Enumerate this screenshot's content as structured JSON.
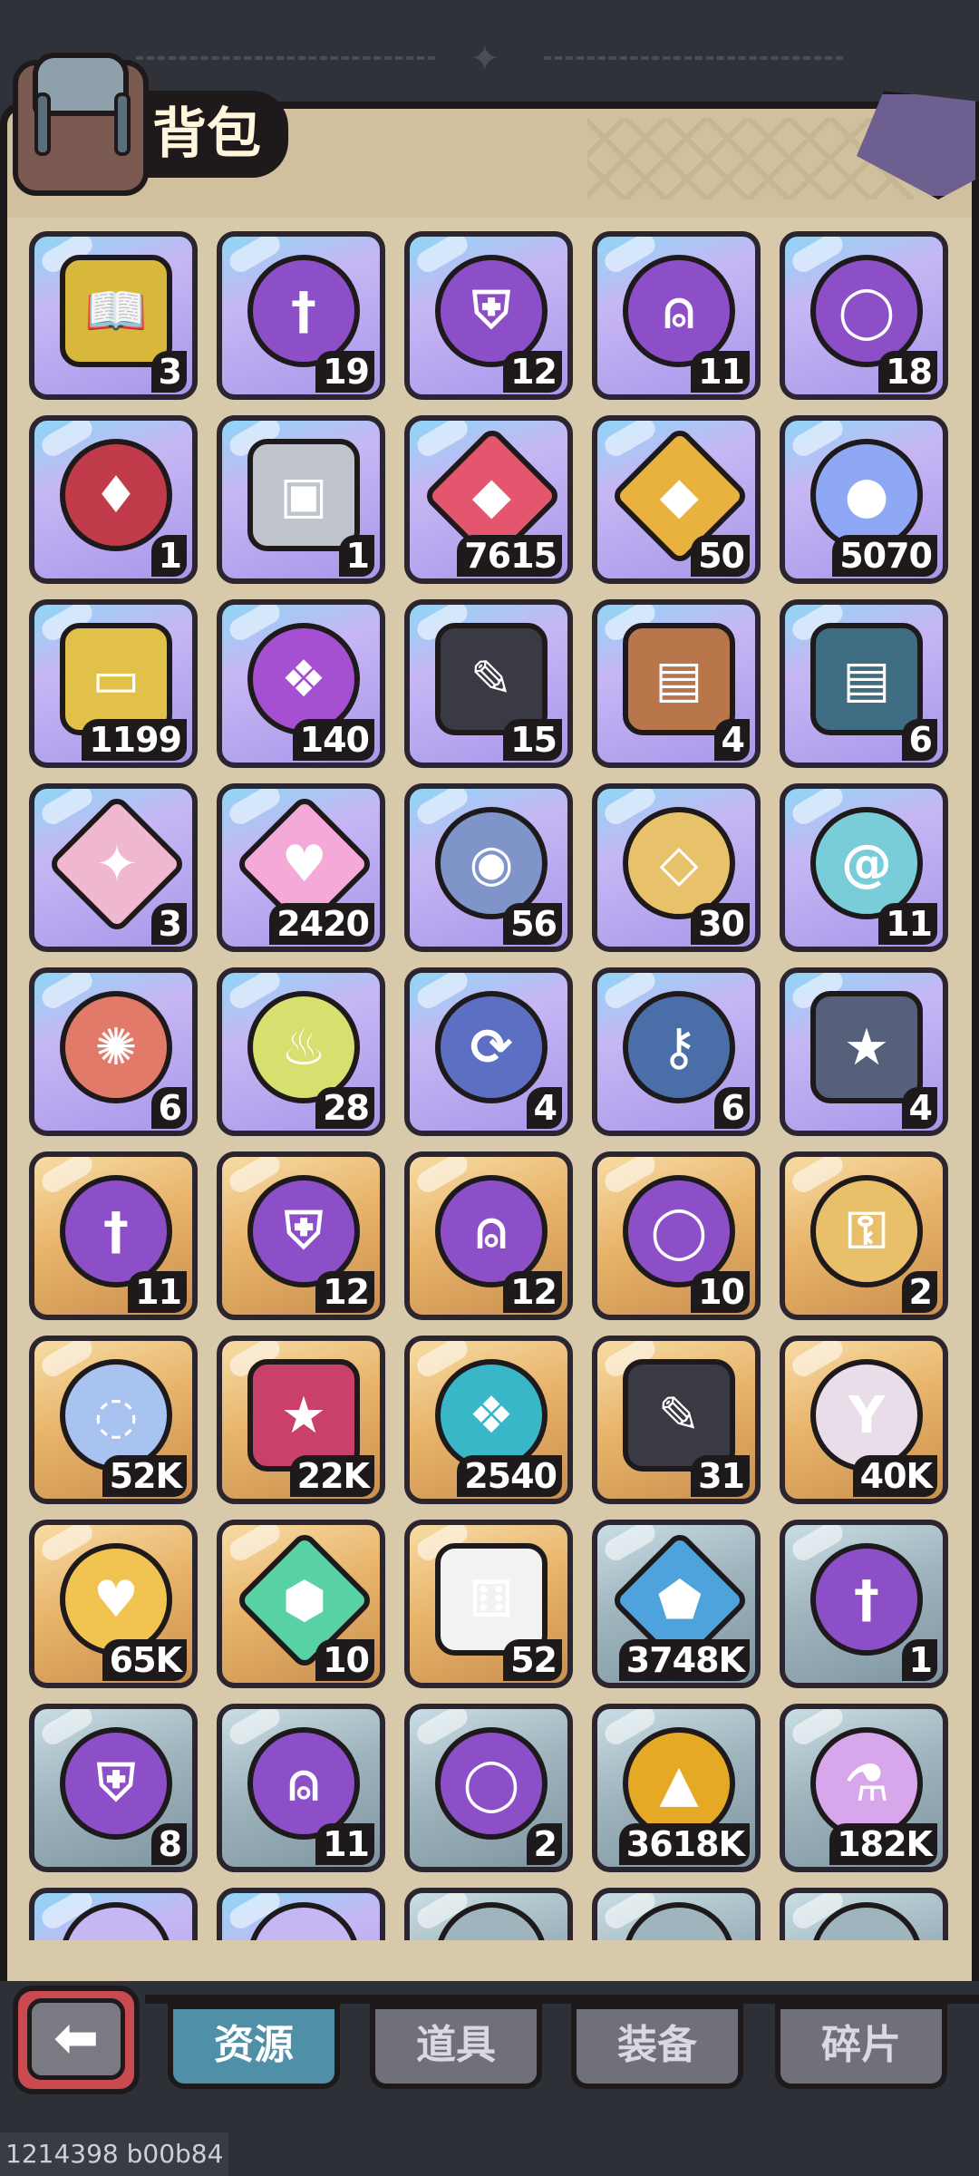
{
  "header": {
    "title": "背包"
  },
  "tabs": [
    {
      "label": "资源",
      "active": true
    },
    {
      "label": "道具",
      "active": false
    },
    {
      "label": "装备",
      "active": false
    },
    {
      "label": "碎片",
      "active": false
    }
  ],
  "items": [
    {
      "icon": "gold-book-icon",
      "count": "3",
      "frame": "purple",
      "color": "#d8b83a"
    },
    {
      "icon": "sword-orb-icon",
      "count": "19",
      "frame": "purple",
      "color": "#8c4fc7"
    },
    {
      "icon": "armor-orb-icon",
      "count": "12",
      "frame": "purple",
      "color": "#8c4fc7"
    },
    {
      "icon": "helmet-orb-icon",
      "count": "11",
      "frame": "purple",
      "color": "#8c4fc7"
    },
    {
      "icon": "ring-orb-icon",
      "count": "18",
      "frame": "purple",
      "color": "#8c4fc7"
    },
    {
      "icon": "winged-helmet-emblem-icon",
      "count": "1",
      "frame": "purple",
      "color": "#c23b4a"
    },
    {
      "icon": "ink-device-icon",
      "count": "1",
      "frame": "purple",
      "color": "#bfc4cc"
    },
    {
      "icon": "red-gem-icon",
      "count": "7615",
      "frame": "purple",
      "color": "#e3566e"
    },
    {
      "icon": "gold-gem-icon",
      "count": "50",
      "frame": "purple",
      "color": "#e9b23e"
    },
    {
      "icon": "blue-slime-icon",
      "count": "5070",
      "frame": "purple",
      "color": "#8fa8f5"
    },
    {
      "icon": "match-ticket-icon",
      "count": "1199",
      "frame": "purple",
      "color": "#e2c14b"
    },
    {
      "icon": "purple-crest-icon",
      "count": "140",
      "frame": "purple",
      "color": "#a54fd1"
    },
    {
      "icon": "feather-box-icon",
      "count": "15",
      "frame": "purple",
      "color": "#3a3a44"
    },
    {
      "icon": "red-helmet-book-icon",
      "count": "4",
      "frame": "purple",
      "color": "#b8764a"
    },
    {
      "icon": "blue-helmet-book-icon",
      "count": "6",
      "frame": "purple",
      "color": "#3f6e84"
    },
    {
      "icon": "prism-crystal-icon",
      "count": "3",
      "frame": "purple",
      "color": "#f0b8d0"
    },
    {
      "icon": "crystal-heart-icon",
      "count": "2420",
      "frame": "purple",
      "color": "#f5a9d8"
    },
    {
      "icon": "eye-stone-icon",
      "count": "56",
      "frame": "purple",
      "color": "#7f95c9"
    },
    {
      "icon": "gold-diamond-stone-icon",
      "count": "30",
      "frame": "purple",
      "color": "#e8c26a"
    },
    {
      "icon": "spiral-stone-icon",
      "count": "11",
      "frame": "purple",
      "color": "#79cdd9"
    },
    {
      "icon": "gear-stone-icon",
      "count": "6",
      "frame": "purple",
      "color": "#e27a6a"
    },
    {
      "icon": "flame-stone-icon",
      "count": "28",
      "frame": "purple",
      "color": "#d7df6e"
    },
    {
      "icon": "refresh-orb-icon",
      "count": "4",
      "frame": "purple",
      "color": "#5d6fc2"
    },
    {
      "icon": "key-icon",
      "count": "6",
      "frame": "purple",
      "color": "#4a6fa8"
    },
    {
      "icon": "star-tome-icon",
      "count": "4",
      "frame": "purple",
      "color": "#56607a"
    },
    {
      "icon": "sword-orb-icon",
      "count": "11",
      "frame": "gold",
      "color": "#8c4fc7"
    },
    {
      "icon": "armor-orb-icon",
      "count": "12",
      "frame": "gold",
      "color": "#8c4fc7"
    },
    {
      "icon": "helmet-orb-icon",
      "count": "12",
      "frame": "gold",
      "color": "#8c4fc7"
    },
    {
      "icon": "ring-orb-icon",
      "count": "10",
      "frame": "gold",
      "color": "#8c4fc7"
    },
    {
      "icon": "gold-key-icon",
      "count": "2",
      "frame": "gold",
      "color": "#e9c06a"
    },
    {
      "icon": "shell-orb-icon",
      "count": "52K",
      "frame": "gold",
      "color": "#a9c3f0"
    },
    {
      "icon": "star-banner-icon",
      "count": "22K",
      "frame": "gold",
      "color": "#c9416b"
    },
    {
      "icon": "teal-crest-icon",
      "count": "2540",
      "frame": "gold",
      "color": "#39b7c9"
    },
    {
      "icon": "feather-box-icon",
      "count": "31",
      "frame": "gold",
      "color": "#3a3a44"
    },
    {
      "icon": "goblet-icon",
      "count": "40K",
      "frame": "gold",
      "color": "#e8dde8"
    },
    {
      "icon": "gold-heart-icon",
      "count": "65K",
      "frame": "gold",
      "color": "#f1c451"
    },
    {
      "icon": "green-crystal-icon",
      "count": "10",
      "frame": "gold",
      "color": "#58d1a4"
    },
    {
      "icon": "dice-icon",
      "count": "52",
      "frame": "gold",
      "color": "#f2f2f2"
    },
    {
      "icon": "blue-crystal-icon",
      "count": "3748K",
      "frame": "grey",
      "color": "#4ea3dc"
    },
    {
      "icon": "sword-orb-icon",
      "count": "1",
      "frame": "grey",
      "color": "#8c4fc7"
    },
    {
      "icon": "armor-orb-icon",
      "count": "8",
      "frame": "grey",
      "color": "#8c4fc7"
    },
    {
      "icon": "helmet-orb-icon",
      "count": "11",
      "frame": "grey",
      "color": "#8c4fc7"
    },
    {
      "icon": "ring-orb-icon",
      "count": "2",
      "frame": "grey",
      "color": "#8c4fc7"
    },
    {
      "icon": "gold-coin-icon",
      "count": "3618K",
      "frame": "grey",
      "color": "#e6a925"
    },
    {
      "icon": "potion-icon",
      "count": "182K",
      "frame": "grey",
      "color": "#d8a6ea"
    },
    {
      "icon": "partial-item-icon",
      "count": "",
      "frame": "purple",
      "color": "#c7b6f4"
    },
    {
      "icon": "partial-item-icon",
      "count": "",
      "frame": "purple",
      "color": "#c7b6f4"
    },
    {
      "icon": "partial-item-icon",
      "count": "",
      "frame": "grey",
      "color": "#9fb4bd"
    },
    {
      "icon": "partial-item-icon",
      "count": "",
      "frame": "grey",
      "color": "#9fb4bd"
    },
    {
      "icon": "partial-item-icon",
      "count": "",
      "frame": "grey",
      "color": "#9fb4bd"
    }
  ],
  "footer": {
    "build_id": "1214398 b00b84"
  },
  "colors": {
    "panel": "#d8c9aa",
    "active_tab": "#4f90a8",
    "inactive_tab": "#6f7079",
    "back_button": "#c94a4f"
  }
}
